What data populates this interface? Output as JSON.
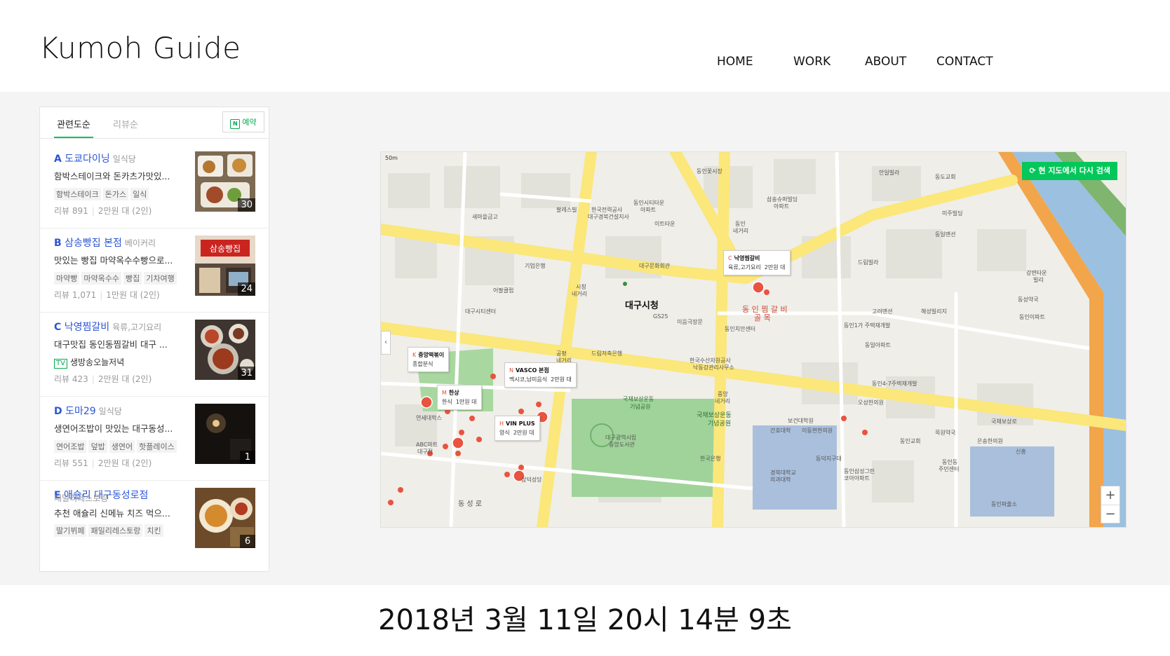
{
  "header": {
    "logo": "Kumoh Guide",
    "nav": [
      "HOME",
      "WORK",
      "ABOUT",
      "CONTACT"
    ]
  },
  "list": {
    "tab_active": "관련도순",
    "tab_inactive": "리뷰순",
    "reserve_label": "예약",
    "items": [
      {
        "letter": "A",
        "name": "도쿄다이닝",
        "category": "일식당",
        "desc": "함박스테이크와 돈카츠가맛있...",
        "tags": [
          "함박스테이크",
          "돈가스",
          "일식"
        ],
        "reviews": "리뷰 891",
        "price": "2만원 대 (2인)",
        "photo_count": "30"
      },
      {
        "letter": "B",
        "name": "삼송빵집 본점",
        "category": "베이커리",
        "desc": "맛있는 빵집 마약옥수수빵으로...",
        "tags": [
          "마약빵",
          "마약옥수수",
          "빵집",
          "기차여행"
        ],
        "reviews": "리뷰 1,071",
        "price": "1만원 대 (2인)",
        "photo_count": "24"
      },
      {
        "letter": "C",
        "name": "낙영찜갈비",
        "category": "육류,고기요리",
        "desc": "대구맛집 동인동찜갈비 대구 ...",
        "tv": "TV",
        "tv_text": "생방송오늘저녁",
        "reviews": "리뷰 423",
        "price": "2만원 대 (2인)",
        "photo_count": "31"
      },
      {
        "letter": "D",
        "name": "도마29",
        "category": "일식당",
        "desc": "생연어조밥이 맛있는 대구동성...",
        "tags": [
          "연어조밥",
          "덮밥",
          "생연어",
          "핫플레이스"
        ],
        "reviews": "리뷰 551",
        "price": "2만원 대 (2인)",
        "photo_count": "1"
      },
      {
        "letter": "E",
        "name": "애슐리 대구동성로점",
        "category": "패밀리레스토랑",
        "desc": "추천 애슐리 신메뉴 치즈 먹으...",
        "tags": [
          "딸기뷔페",
          "패밀리레스토랑",
          "치킨"
        ],
        "photo_count": "6"
      }
    ]
  },
  "map": {
    "research_label": "현 지도에서 다시 검색",
    "scale_label": "50m",
    "city_hall": "대구시청",
    "zoom_in": "+",
    "zoom_out": "−",
    "left_handle": "‹",
    "bubble_c": {
      "letter": "C",
      "name": "낙영찜갈비",
      "sub": "육류,고기요리",
      "price": "2만원 대"
    },
    "bubble_k": {
      "letter": "K",
      "name": "중앙떡볶이",
      "sub": "종합분식"
    },
    "bubble_n": {
      "letter": "N",
      "name": "VASCO 본점",
      "sub": "멕시코,남미음식",
      "price": "2만원 대"
    },
    "bubble_m": {
      "letter": "M",
      "name": "한상",
      "sub": "한식",
      "price": "1만원 대"
    },
    "bubble_h": {
      "letter": "H",
      "name": "VIN PLUS",
      "sub": "양식",
      "price": "2만원 대"
    },
    "labels": [
      "동인꽃시장",
      "안일빌라",
      "동도교회",
      "삼송슈퍼빌딩 아파트",
      "미주빌딩",
      "동일맨션",
      "GS25",
      "기업은행",
      "대구문화회관",
      "국채보상운동 기념공원",
      "국채보상로",
      "한국은행",
      "오성한의원",
      "동인교회",
      "동인4-7주택재개발",
      "경북대학교 의과대학",
      "간호대학",
      "동덕지구대",
      "동인동 주민센터",
      "동인삼성그린 코아아파트",
      "보건대학원",
      "이동현한의원",
      "목원약국",
      "은송한의원",
      "동인파출소",
      "신흥",
      "구세계의원",
      "대구전력공사 대구경북건설지사",
      "팔레스빌",
      "동인시티타운 아파트",
      "이트타운",
      "어팔클럽",
      "대구시티센터",
      "드림저축은행",
      "이음극장문",
      "동인치안센터",
      "한국수산자원공사 낙동강관리사무소",
      "대구광역시립 중앙도서관",
      "삼덕성당",
      "동성로",
      "ABC마트 대구점",
      "연세대학스",
      "해성빌리지",
      "드림빌라",
      "고려맨션",
      "동일아파트",
      "강변타운 빌리",
      "동성약국",
      "동인이파트",
      "동인1가 주택재개발",
      "공평 네거리",
      "중앙 네거리",
      "시청 네거리",
      "동인 네거리"
    ]
  },
  "footer": {
    "timestamp": "2018년 3월 11일 20시 14분 9초"
  }
}
